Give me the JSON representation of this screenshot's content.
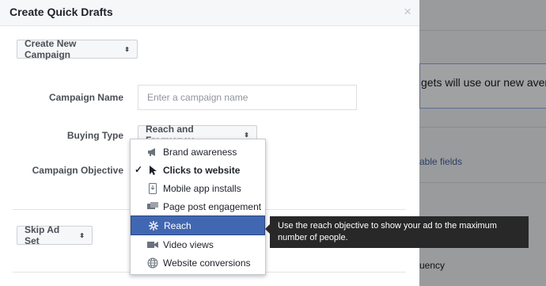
{
  "dialog": {
    "title": "Create Quick Drafts",
    "close_label": "×",
    "create_campaign_button": "Create New Campaign",
    "campaign_name_label": "Campaign Name",
    "campaign_name_placeholder": "Enter a campaign name",
    "buying_type_label": "Buying Type",
    "buying_type_value": "Reach and Frequency",
    "campaign_objective_label": "Campaign Objective",
    "skip_ad_set_button": "Skip Ad Set"
  },
  "objective_menu": {
    "checked_item": "Clicks to website",
    "highlighted_item": "Reach",
    "items": [
      {
        "label": "Brand awareness",
        "icon": "megaphone-icon"
      },
      {
        "label": "Clicks to website",
        "icon": "cursor-icon"
      },
      {
        "label": "Mobile app installs",
        "icon": "mobile-app-icon"
      },
      {
        "label": "Page post engagement",
        "icon": "engagement-icon"
      },
      {
        "label": "Reach",
        "icon": "reach-icon"
      },
      {
        "label": "Video views",
        "icon": "video-camera-icon"
      },
      {
        "label": "Website conversions",
        "icon": "globe-icon"
      }
    ]
  },
  "tooltip": {
    "text": "Use the reach objective to show your ad to the maximum number of people."
  },
  "background": {
    "notice_text": "gets will use our new avera",
    "link_text": "able fields",
    "frequency_text": "uency"
  },
  "colors": {
    "accent": "#4267b2",
    "tooltip_bg": "#282828",
    "overlay": "#9a9b9d"
  }
}
